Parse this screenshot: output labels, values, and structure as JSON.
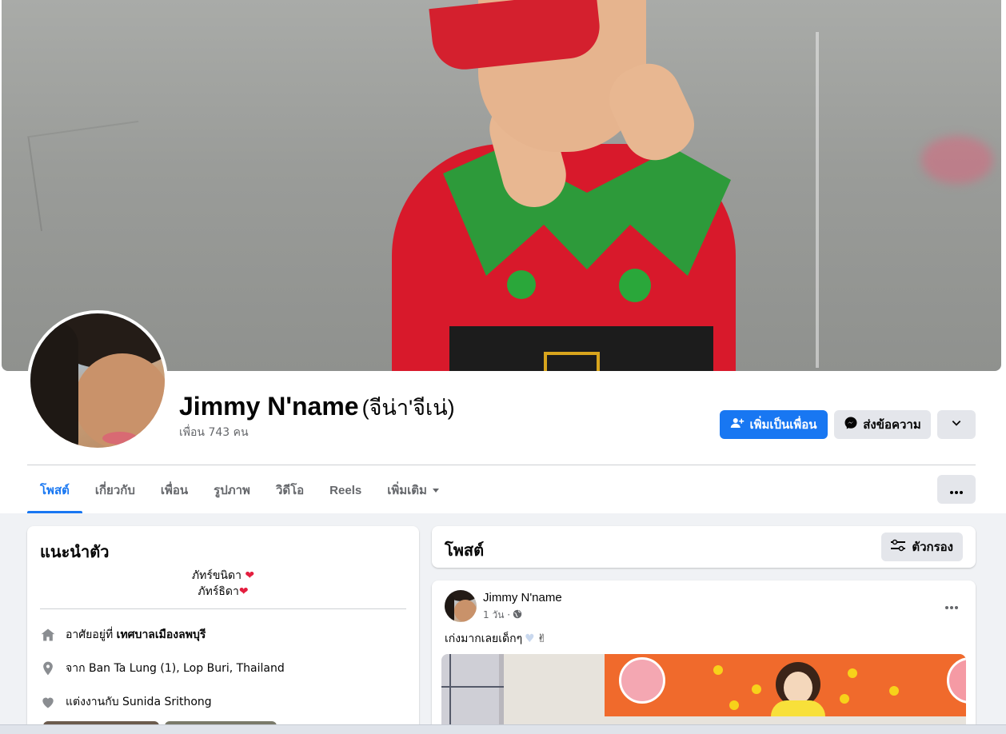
{
  "profile": {
    "name": "Jimmy N'name",
    "alternate_name": "(จีน่า'จีเน่)",
    "friends_count": "เพื่อน 743 คน"
  },
  "actions": {
    "add_friend": "เพิ่มเป็นเพื่อน",
    "message": "ส่งข้อความ"
  },
  "tabs": [
    {
      "label": "โพสต์",
      "active": true
    },
    {
      "label": "เกี่ยวกับ",
      "active": false
    },
    {
      "label": "เพื่อน",
      "active": false
    },
    {
      "label": "รูปภาพ",
      "active": false
    },
    {
      "label": "วิดีโอ",
      "active": false
    },
    {
      "label": "Reels",
      "active": false
    },
    {
      "label": "เพิ่มเติม",
      "active": false
    }
  ],
  "intro": {
    "title": "แนะนำตัว",
    "bio_line1": "ภัทร์ขนิดา",
    "bio_line2": "ภัทร์ธิดา",
    "lives_in_prefix": "อาศัยอยู่ที่ ",
    "lives_in_place": "เทศบาลเมืองลพบุรี",
    "from_text": "จาก Ban Ta Lung (1), Lop Buri, Thailand",
    "relationship_text": "แต่งงานกับ Sunida Srithong"
  },
  "posts": {
    "title": "โพสต์",
    "filter_label": "ตัวกรอง"
  },
  "post": {
    "author": "Jimmy N'name",
    "time": "1 วัน ·",
    "text": "เก่งมากเลยเด็กๆ"
  },
  "colors": {
    "accent": "#1877f2",
    "secondary_button": "#e4e6eb",
    "page_background": "#f0f2f5",
    "heart": "#e41e3f"
  },
  "icons": {
    "add_friend": "add-person-icon",
    "message": "messenger-icon",
    "more": "chevron-down-icon",
    "home": "home-icon",
    "location": "location-pin-icon",
    "relationship": "heart-icon",
    "filter": "filter-sliders-icon",
    "privacy": "globe-icon"
  }
}
